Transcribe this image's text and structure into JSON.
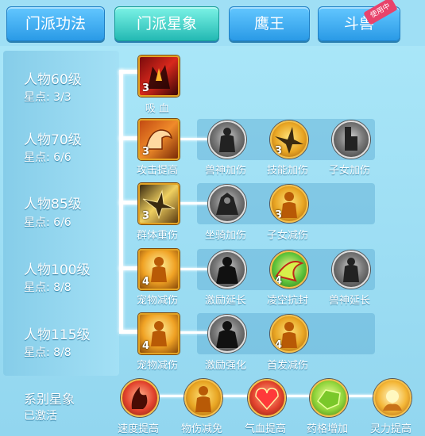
{
  "tabs": [
    {
      "label": "门派功法",
      "active": false
    },
    {
      "label": "门派星象",
      "active": true
    },
    {
      "label": "鹰王",
      "active": false
    },
    {
      "label": "斗兽",
      "active": false,
      "badge": "使用中"
    }
  ],
  "tiers": [
    {
      "level": "人物60级",
      "stars": "星点: 3/3"
    },
    {
      "level": "人物70级",
      "stars": "星点: 6/6"
    },
    {
      "level": "人物85级",
      "stars": "星点: 6/6"
    },
    {
      "level": "人物100级",
      "stars": "星点: 8/8"
    },
    {
      "level": "人物115级",
      "stars": "星点: 8/8"
    }
  ],
  "main_skills": [
    {
      "name": "吸 血",
      "level": "3",
      "icon": "blood-suck-icon"
    },
    {
      "name": "攻击提高",
      "level": "3",
      "icon": "muscle-arm-icon"
    },
    {
      "name": "群体重伤",
      "level": "3",
      "icon": "eagle-icon"
    },
    {
      "name": "宠物减伤",
      "level": "4",
      "icon": "golden-figure-icon"
    },
    {
      "name": "宠物减伤",
      "level": "4",
      "icon": "golden-figure-icon"
    }
  ],
  "sub_skills": {
    "row70": [
      {
        "name": "兽神加伤",
        "level": "",
        "icon": "beast-god-icon"
      },
      {
        "name": "技能加伤",
        "level": "3",
        "icon": "golden-eagle-icon"
      },
      {
        "name": "子女加伤",
        "level": "",
        "icon": "raised-fist-icon"
      }
    ],
    "row85": [
      {
        "name": "坐骑加伤",
        "level": "",
        "icon": "mount-icon"
      },
      {
        "name": "子女减伤",
        "level": "3",
        "icon": "golden-figure-icon"
      }
    ],
    "row100": [
      {
        "name": "激励延长",
        "level": "",
        "icon": "dark-figure-icon"
      },
      {
        "name": "凌空抗封",
        "level": "4",
        "icon": "green-swirl-icon"
      },
      {
        "name": "兽神延长",
        "level": "",
        "icon": "beast-god-icon"
      }
    ],
    "row115": [
      {
        "name": "激励强化",
        "level": "",
        "icon": "dark-figure-icon"
      },
      {
        "name": "首发减伤",
        "level": "4",
        "icon": "golden-figure-icon"
      }
    ]
  },
  "constellation": {
    "title": "系别星象",
    "status": "已激活",
    "items": [
      {
        "name": "速度提高",
        "icon": "speed-flame-icon"
      },
      {
        "name": "物伤减免",
        "icon": "golden-figure-icon"
      },
      {
        "name": "气血提高",
        "icon": "heart-icon"
      },
      {
        "name": "药格增加",
        "icon": "green-gem-icon"
      },
      {
        "name": "灵力提高",
        "icon": "radiant-hand-icon"
      }
    ]
  }
}
